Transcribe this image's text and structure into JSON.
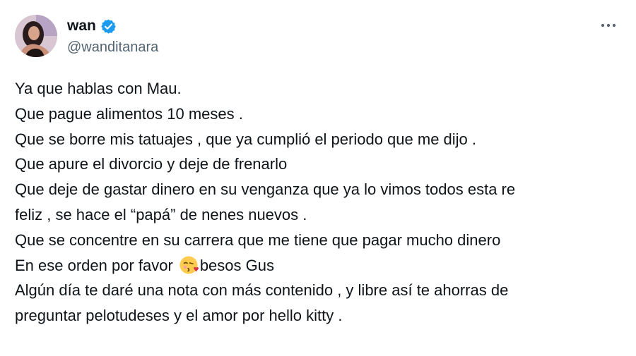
{
  "author": {
    "display_name": "wan",
    "handle": "@wanditanara",
    "verified": true
  },
  "icons": {
    "avatar": "profile-photo",
    "verified": "verified-badge-icon",
    "more": "more-options-icon",
    "emoji": "face-blowing-kiss-emoji"
  },
  "colors": {
    "text": "#0f1419",
    "secondary": "#536471",
    "verified_blue": "#1d9bf0"
  },
  "tweet": {
    "lines": [
      "Ya que hablas con Mau.",
      "Que pague alimentos 10 meses .",
      "Que se borre mis tatuajes , que ya cumplió el periodo que me dijo .",
      "Que apure el divorcio y deje de frenarlo",
      "Que deje de gastar dinero en su venganza que ya lo vimos todos esta re",
      "feliz , se hace el “papá” de nenes nuevos .",
      "Que se concentre en su carrera que me tiene que pagar mucho dinero",
      "En ese orden por favor",
      "besos Gus",
      "Algún día te daré una nota con más contenido , y libre así te ahorras de",
      "preguntar pelotudeses y el amor por hello kitty ."
    ]
  }
}
